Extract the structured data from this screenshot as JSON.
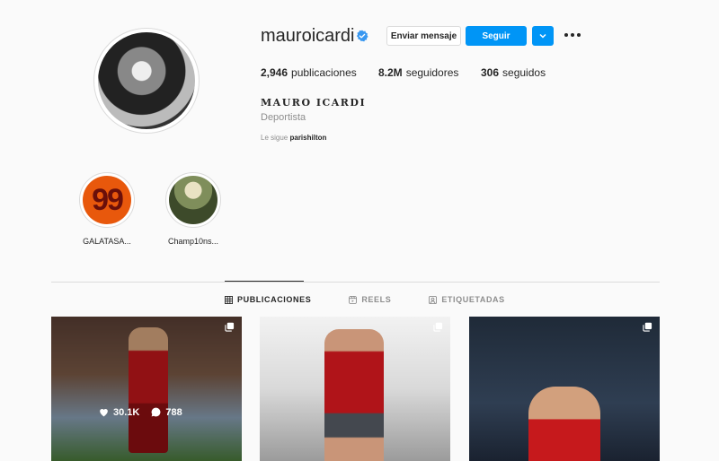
{
  "profile": {
    "username": "mauroicardi",
    "verified": true,
    "full_name": "MAURO ICARDI",
    "category": "Deportista",
    "followed_by_prefix": "Le sigue",
    "followed_by_user": "parishilton"
  },
  "actions": {
    "message_label": "Enviar mensaje",
    "follow_label": "Seguir"
  },
  "stats": {
    "posts_value": "2,946",
    "posts_label": "publicaciones",
    "followers_value": "8.2M",
    "followers_label": "seguidores",
    "following_value": "306",
    "following_label": "seguidos"
  },
  "highlights": [
    {
      "label": "GALATASA...",
      "badge": "99"
    },
    {
      "label": "Champ10ns..."
    }
  ],
  "tabs": [
    {
      "label": "PUBLICACIONES",
      "icon": "grid-icon",
      "active": true
    },
    {
      "label": "REELS",
      "icon": "reels-icon",
      "active": false
    },
    {
      "label": "ETIQUETADAS",
      "icon": "tagged-icon",
      "active": false
    }
  ],
  "posts": [
    {
      "likes": "30.1K",
      "comments": "788",
      "hover": true
    },
    {
      "hover": false
    },
    {
      "hover": false
    }
  ],
  "colors": {
    "accent": "#0095f6",
    "verified": "#3897f0",
    "text": "#262626",
    "muted": "#8e8e8e",
    "border": "#dbdbdb"
  }
}
